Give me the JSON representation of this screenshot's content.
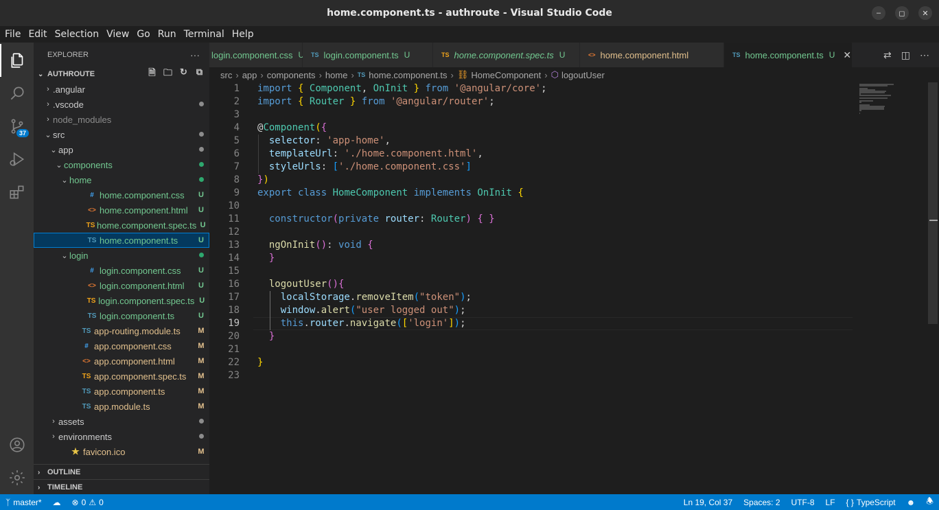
{
  "window": {
    "title": "home.component.ts - authroute - Visual Studio Code"
  },
  "menu": [
    "File",
    "Edit",
    "Selection",
    "View",
    "Go",
    "Run",
    "Terminal",
    "Help"
  ],
  "activity": {
    "scm_badge": "37"
  },
  "explorer": {
    "header": "EXPLORER",
    "more": "···",
    "project": "AUTHROUTE",
    "tree": [
      {
        "label": ".angular",
        "indent": 0,
        "chev": "›",
        "icon": "",
        "icon_name": "",
        "status": "",
        "dot": "",
        "cls": ""
      },
      {
        "label": ".vscode",
        "indent": 0,
        "chev": "›",
        "icon": "",
        "icon_name": "",
        "status": "",
        "dot": "#8c8c8c",
        "cls": ""
      },
      {
        "label": "node_modules",
        "indent": 0,
        "chev": "›",
        "icon": "",
        "icon_name": "",
        "status": "",
        "dot": "",
        "cls": "ignored"
      },
      {
        "label": "src",
        "indent": 0,
        "chev": "⌄",
        "icon": "",
        "icon_name": "",
        "status": "",
        "dot": "#8c8c8c",
        "cls": ""
      },
      {
        "label": "app",
        "indent": 1,
        "chev": "⌄",
        "icon": "",
        "icon_name": "",
        "status": "",
        "dot": "#8c8c8c",
        "cls": ""
      },
      {
        "label": "components",
        "indent": 2,
        "chev": "⌄",
        "icon": "",
        "icon_name": "",
        "status": "",
        "dot": "#2ea86e",
        "cls": "untracked"
      },
      {
        "label": "home",
        "indent": 3,
        "chev": "⌄",
        "icon": "",
        "icon_name": "",
        "status": "",
        "dot": "#2ea86e",
        "cls": "untracked"
      },
      {
        "label": "home.component.css",
        "indent": 4,
        "chev": "",
        "icon": "#",
        "icon_name": "css-file-icon",
        "icls": "ic-css",
        "status": "U",
        "dot": "",
        "cls": "untracked"
      },
      {
        "label": "home.component.html",
        "indent": 4,
        "chev": "",
        "icon": "<>",
        "icon_name": "html-file-icon",
        "icls": "ic-html",
        "status": "U",
        "dot": "",
        "cls": "untracked"
      },
      {
        "label": "home.component.spec.ts",
        "indent": 4,
        "chev": "",
        "icon": "TS",
        "icon_name": "spec-ts-file-icon",
        "icls": "ic-spec",
        "status": "U",
        "dot": "",
        "cls": "untracked"
      },
      {
        "label": "home.component.ts",
        "indent": 4,
        "chev": "",
        "icon": "TS",
        "icon_name": "ts-file-icon",
        "icls": "ic-ts",
        "status": "U",
        "dot": "",
        "cls": "untracked",
        "selected": true
      },
      {
        "label": "login",
        "indent": 3,
        "chev": "⌄",
        "icon": "",
        "icon_name": "",
        "status": "",
        "dot": "#2ea86e",
        "cls": "untracked"
      },
      {
        "label": "login.component.css",
        "indent": 4,
        "chev": "",
        "icon": "#",
        "icon_name": "css-file-icon",
        "icls": "ic-css",
        "status": "U",
        "dot": "",
        "cls": "untracked"
      },
      {
        "label": "login.component.html",
        "indent": 4,
        "chev": "",
        "icon": "<>",
        "icon_name": "html-file-icon",
        "icls": "ic-html",
        "status": "U",
        "dot": "",
        "cls": "untracked"
      },
      {
        "label": "login.component.spec.ts",
        "indent": 4,
        "chev": "",
        "icon": "TS",
        "icon_name": "spec-ts-file-icon",
        "icls": "ic-spec",
        "status": "U",
        "dot": "",
        "cls": "untracked"
      },
      {
        "label": "login.component.ts",
        "indent": 4,
        "chev": "",
        "icon": "TS",
        "icon_name": "ts-file-icon",
        "icls": "ic-ts",
        "status": "U",
        "dot": "",
        "cls": "untracked"
      },
      {
        "label": "app-routing.module.ts",
        "indent": 3,
        "chev": "",
        "icon": "TS",
        "icon_name": "ts-file-icon",
        "icls": "ic-ts",
        "status": "M",
        "dot": "",
        "cls": "modified"
      },
      {
        "label": "app.component.css",
        "indent": 3,
        "chev": "",
        "icon": "#",
        "icon_name": "css-file-icon",
        "icls": "ic-css",
        "status": "M",
        "dot": "",
        "cls": "modified"
      },
      {
        "label": "app.component.html",
        "indent": 3,
        "chev": "",
        "icon": "<>",
        "icon_name": "html-file-icon",
        "icls": "ic-html",
        "status": "M",
        "dot": "",
        "cls": "modified"
      },
      {
        "label": "app.component.spec.ts",
        "indent": 3,
        "chev": "",
        "icon": "TS",
        "icon_name": "spec-ts-file-icon",
        "icls": "ic-spec",
        "status": "M",
        "dot": "",
        "cls": "modified"
      },
      {
        "label": "app.component.ts",
        "indent": 3,
        "chev": "",
        "icon": "TS",
        "icon_name": "ts-file-icon",
        "icls": "ic-ts",
        "status": "M",
        "dot": "",
        "cls": "modified"
      },
      {
        "label": "app.module.ts",
        "indent": 3,
        "chev": "",
        "icon": "TS",
        "icon_name": "ts-file-icon",
        "icls": "ic-ts",
        "status": "M",
        "dot": "",
        "cls": "modified"
      },
      {
        "label": "assets",
        "indent": 1,
        "chev": "›",
        "icon": "",
        "icon_name": "",
        "status": "",
        "dot": "#8c8c8c",
        "cls": ""
      },
      {
        "label": "environments",
        "indent": 1,
        "chev": "›",
        "icon": "",
        "icon_name": "",
        "status": "",
        "dot": "#8c8c8c",
        "cls": ""
      },
      {
        "label": "favicon.ico",
        "indent": 1,
        "chev": "",
        "icon": "★",
        "icon_name": "favicon-icon",
        "icls": "ic-star",
        "status": "M",
        "dot": "",
        "cls": "modified"
      }
    ],
    "outline": "OUTLINE",
    "timeline": "TIMELINE"
  },
  "tabs": [
    {
      "label": "login.component.css",
      "icon": "",
      "icls": "",
      "status": "U",
      "italic": false,
      "active": false,
      "cut": true
    },
    {
      "label": "login.component.ts",
      "icon": "TS",
      "icls": "ic-ts",
      "status": "U",
      "italic": false,
      "active": false
    },
    {
      "label": "home.component.spec.ts",
      "icon": "TS",
      "icls": "ic-spec",
      "status": "U",
      "italic": true,
      "active": false
    },
    {
      "label": "home.component.html",
      "icon": "<>",
      "icls": "ic-html",
      "status": "",
      "italic": false,
      "active": false
    },
    {
      "label": "home.component.ts",
      "icon": "TS",
      "icls": "ic-ts",
      "status": "U",
      "italic": false,
      "active": true
    }
  ],
  "breadcrumb": [
    "src",
    "app",
    "components",
    "home",
    "home.component.ts",
    "HomeComponent",
    "logoutUser"
  ],
  "editor": {
    "current_line": 19,
    "lines": [
      [
        [
          "k",
          "import"
        ],
        [
          "p",
          " "
        ],
        [
          "b1",
          "{"
        ],
        [
          "p",
          " "
        ],
        [
          "t",
          "Component"
        ],
        [
          "p",
          ", "
        ],
        [
          "t",
          "OnInit"
        ],
        [
          "p",
          " "
        ],
        [
          "b1",
          "}"
        ],
        [
          "p",
          " "
        ],
        [
          "k",
          "from"
        ],
        [
          "p",
          " "
        ],
        [
          "s",
          "'@angular/core'"
        ],
        [
          "p",
          ";"
        ]
      ],
      [
        [
          "k",
          "import"
        ],
        [
          "p",
          " "
        ],
        [
          "b1",
          "{"
        ],
        [
          "p",
          " "
        ],
        [
          "t",
          "Router"
        ],
        [
          "p",
          " "
        ],
        [
          "b1",
          "}"
        ],
        [
          "p",
          " "
        ],
        [
          "k",
          "from"
        ],
        [
          "p",
          " "
        ],
        [
          "s",
          "'@angular/router'"
        ],
        [
          "p",
          ";"
        ]
      ],
      [],
      [
        [
          "p",
          "@"
        ],
        [
          "t",
          "Component"
        ],
        [
          "b1",
          "("
        ],
        [
          "b2",
          "{"
        ]
      ],
      [
        [
          "p",
          "  "
        ],
        [
          "v",
          "selector"
        ],
        [
          "p",
          ": "
        ],
        [
          "s",
          "'app-home'"
        ],
        [
          "p",
          ","
        ]
      ],
      [
        [
          "p",
          "  "
        ],
        [
          "v",
          "templateUrl"
        ],
        [
          "p",
          ": "
        ],
        [
          "s",
          "'./home.component.html'"
        ],
        [
          "p",
          ","
        ]
      ],
      [
        [
          "p",
          "  "
        ],
        [
          "v",
          "styleUrls"
        ],
        [
          "p",
          ": "
        ],
        [
          "b3",
          "["
        ],
        [
          "s",
          "'./home.component.css'"
        ],
        [
          "b3",
          "]"
        ]
      ],
      [
        [
          "b2",
          "}"
        ],
        [
          "b1",
          ")"
        ]
      ],
      [
        [
          "k",
          "export"
        ],
        [
          "p",
          " "
        ],
        [
          "k",
          "class"
        ],
        [
          "p",
          " "
        ],
        [
          "t",
          "HomeComponent"
        ],
        [
          "p",
          " "
        ],
        [
          "k",
          "implements"
        ],
        [
          "p",
          " "
        ],
        [
          "t",
          "OnInit"
        ],
        [
          "p",
          " "
        ],
        [
          "b1",
          "{"
        ]
      ],
      [],
      [
        [
          "p",
          "  "
        ],
        [
          "k",
          "constructor"
        ],
        [
          "b2",
          "("
        ],
        [
          "k",
          "private"
        ],
        [
          "p",
          " "
        ],
        [
          "v",
          "router"
        ],
        [
          "p",
          ": "
        ],
        [
          "t",
          "Router"
        ],
        [
          "b2",
          ")"
        ],
        [
          "p",
          " "
        ],
        [
          "b2",
          "{"
        ],
        [
          "p",
          " "
        ],
        [
          "b2",
          "}"
        ]
      ],
      [],
      [
        [
          "p",
          "  "
        ],
        [
          "f",
          "ngOnInit"
        ],
        [
          "b2",
          "("
        ],
        [
          "b2",
          ")"
        ],
        [
          "p",
          ": "
        ],
        [
          "k",
          "void"
        ],
        [
          "p",
          " "
        ],
        [
          "b2",
          "{"
        ]
      ],
      [
        [
          "p",
          "  "
        ],
        [
          "b2",
          "}"
        ]
      ],
      [],
      [
        [
          "p",
          "  "
        ],
        [
          "f",
          "logoutUser"
        ],
        [
          "b2",
          "("
        ],
        [
          "b2",
          ")"
        ],
        [
          "b2",
          "{"
        ]
      ],
      [
        [
          "p",
          "    "
        ],
        [
          "v",
          "localStorage"
        ],
        [
          "p",
          "."
        ],
        [
          "f",
          "removeItem"
        ],
        [
          "b3",
          "("
        ],
        [
          "s",
          "\"token\""
        ],
        [
          "b3",
          ")"
        ],
        [
          "p",
          ";"
        ]
      ],
      [
        [
          "p",
          "    "
        ],
        [
          "v",
          "window"
        ],
        [
          "p",
          "."
        ],
        [
          "f",
          "alert"
        ],
        [
          "b3",
          "("
        ],
        [
          "s",
          "\"user logged out\""
        ],
        [
          "b3",
          ")"
        ],
        [
          "p",
          ";"
        ]
      ],
      [
        [
          "p",
          "    "
        ],
        [
          "k",
          "this"
        ],
        [
          "p",
          "."
        ],
        [
          "v",
          "router"
        ],
        [
          "p",
          "."
        ],
        [
          "f",
          "navigate"
        ],
        [
          "b3",
          "("
        ],
        [
          "b1",
          "["
        ],
        [
          "s",
          "'login'"
        ],
        [
          "b1",
          "]"
        ],
        [
          "b3",
          ")"
        ],
        [
          "p",
          ";"
        ]
      ],
      [
        [
          "p",
          "  "
        ],
        [
          "b2",
          "}"
        ]
      ],
      [],
      [
        [
          "b1",
          "}"
        ]
      ],
      []
    ]
  },
  "status": {
    "branch": "master*",
    "errors": "0",
    "warnings": "0",
    "position": "Ln 19, Col 37",
    "spaces": "Spaces: 2",
    "encoding": "UTF-8",
    "eol": "LF",
    "language": "TypeScript"
  },
  "colors": {
    "statusbar": "#007acc",
    "untracked": "#73c991",
    "modified": "#e2c08d"
  }
}
